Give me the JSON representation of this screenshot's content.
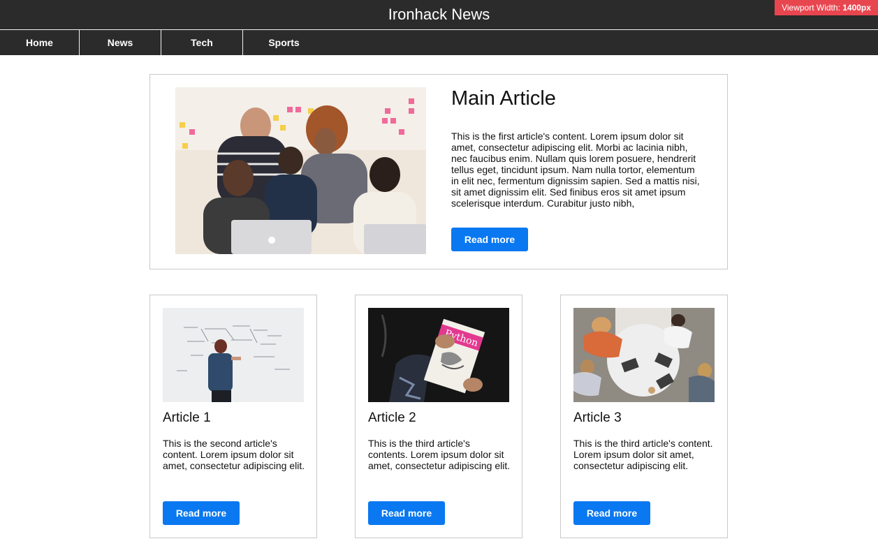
{
  "header": {
    "site_title": "Ironhack News",
    "viewport_label": "Viewport Width:",
    "viewport_value": "1400px"
  },
  "nav": {
    "items": [
      {
        "label": "Home"
      },
      {
        "label": "News"
      },
      {
        "label": "Tech"
      },
      {
        "label": "Sports"
      }
    ]
  },
  "main_article": {
    "title": "Main Article",
    "body": "This is the first article's content. Lorem ipsum dolor sit amet, consectetur adipiscing elit. Morbi ac lacinia nibh, nec faucibus enim. Nullam quis lorem posuere, hendrerit tellus eget, tincidunt ipsum. Nam nulla tortor, elementum in elit nec, fermentum dignissim sapien. Sed a mattis nisi, sit amet dignissim elit. Sed finibus eros sit amet ipsum scelerisque interdum. Curabitur justo nibh,",
    "button_label": "Read more",
    "image_icon": "team-photo"
  },
  "articles": [
    {
      "title": "Article 1",
      "body": "This is the second article's content. Lorem ipsum dolor sit amet, consectetur adipiscing elit.",
      "button_label": "Read more",
      "image_icon": "whiteboard-photo"
    },
    {
      "title": "Article 2",
      "body": "This is the third article's contents. Lorem ipsum dolor sit amet, consectetur adipiscing elit.",
      "button_label": "Read more",
      "image_icon": "python-book-photo"
    },
    {
      "title": "Article 3",
      "body": "This is the third article's content. Lorem ipsum dolor sit amet, consectetur adipiscing elit.",
      "button_label": "Read more",
      "image_icon": "laptops-table-photo"
    }
  ],
  "colors": {
    "header_bg": "#2b2b2b",
    "button": "#0a78f0",
    "badge": "#e8464f"
  }
}
